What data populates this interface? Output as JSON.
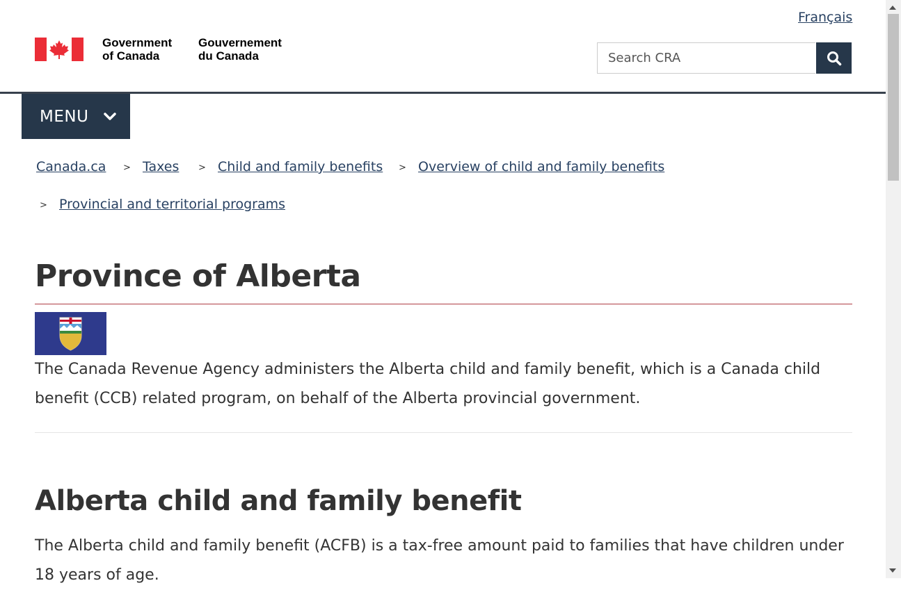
{
  "header": {
    "language_link": "Français",
    "signature_en": [
      "Government",
      "of Canada"
    ],
    "signature_fr": [
      "Gouvernement",
      "du Canada"
    ],
    "search": {
      "placeholder": "Search CRA",
      "value": ""
    },
    "search_button_icon": "search-icon",
    "menu_label": "MENU",
    "menu_icon": "chevron-down-icon"
  },
  "breadcrumb": [
    "Canada.ca",
    "Taxes",
    "Child and family benefits",
    "Overview of child and family benefits",
    "Provincial and territorial programs"
  ],
  "breadcrumb_separator": ">",
  "main": {
    "title": "Province of Alberta",
    "intro": "The Canada Revenue Agency administers the Alberta child and family benefit, which is a Canada child benefit (CCB) related program, on behalf of the Alberta provincial government.",
    "section_heading": "Alberta child and family benefit",
    "section_text": "The Alberta child and family benefit (ACFB) is a tax-free amount paid to families that have children under 18 years of age."
  },
  "colors": {
    "link": "#284162",
    "button_bg": "#26374a",
    "title_rule": "#af3c43",
    "canada_red": "#eb2d37",
    "alberta_blue": "#2e3a8c"
  }
}
